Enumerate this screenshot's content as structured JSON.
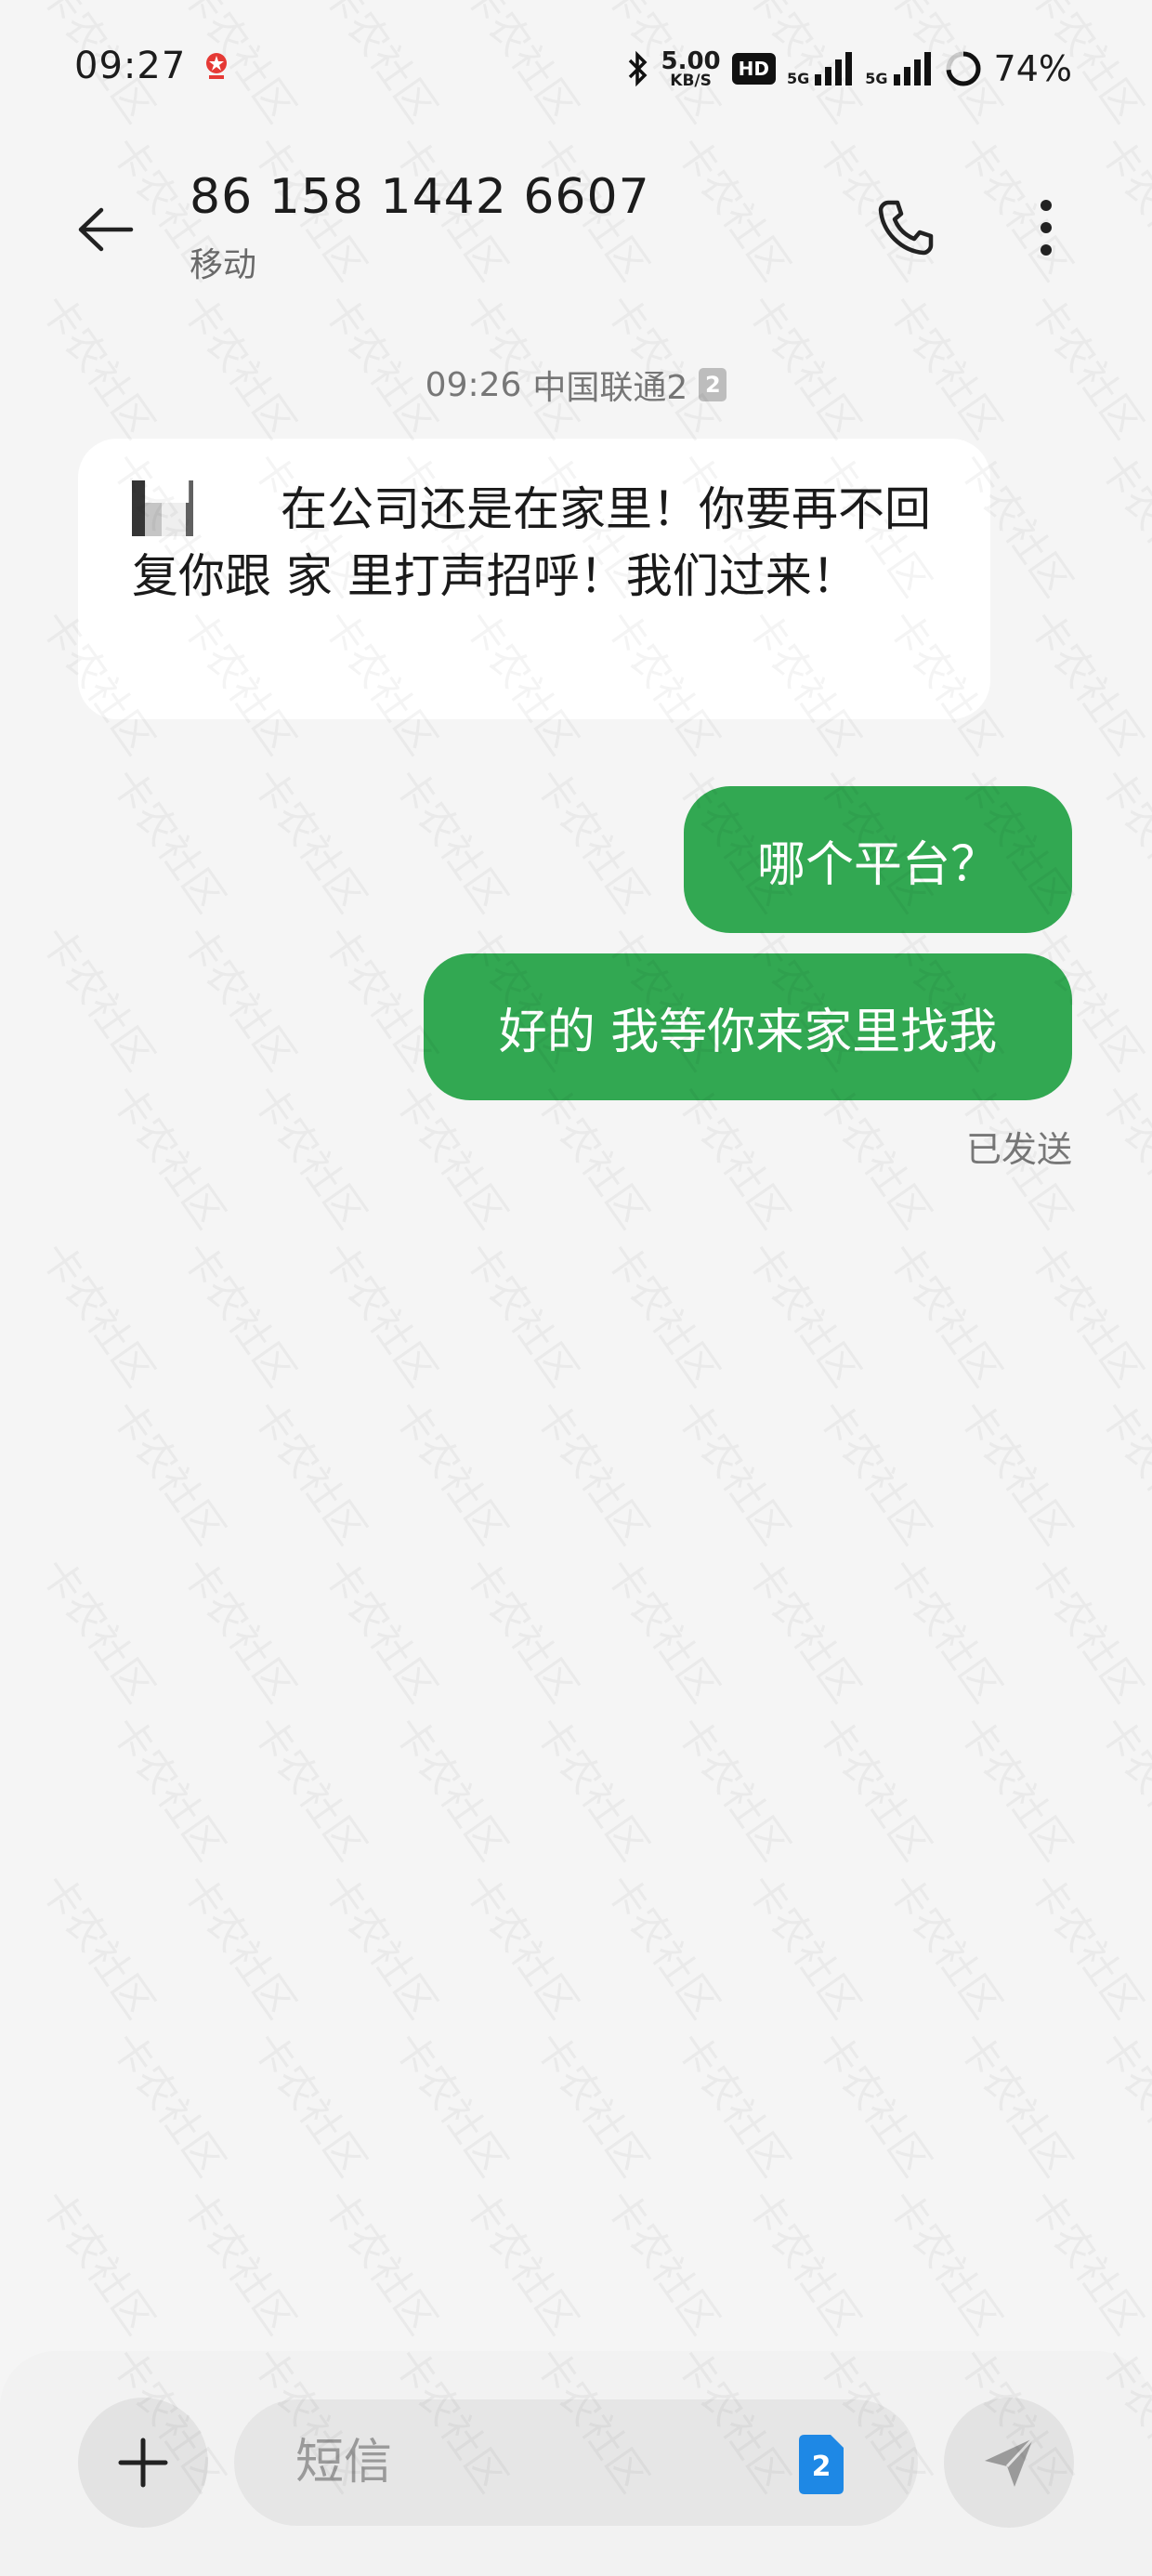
{
  "status_bar": {
    "time": "09:27",
    "net_speed_value": "5.00",
    "net_speed_unit": "KB/S",
    "hd_label": "HD",
    "net1_label": "5G",
    "net2_label": "5G",
    "battery_percent": "74%"
  },
  "header": {
    "contact_number": "86 158 1442 6607",
    "contact_carrier": "移动"
  },
  "conversation": {
    "timestamp": "09:26",
    "carrier_label": "中国联通2",
    "sim_badge": "2",
    "incoming_messages": [
      {
        "text": "在公司还是在家里！你要再不回复你跟 家 里打声招呼！我们过来！"
      }
    ],
    "outgoing_messages": [
      {
        "text": "哪个平台？"
      },
      {
        "text": "好的 我等你来家里找我"
      }
    ],
    "sent_status": "已发送"
  },
  "composer": {
    "placeholder": "短信"
  },
  "watermark_text": "卡农社区",
  "colors": {
    "outgoing_bubble": "#32a852",
    "incoming_bubble": "#ffffff",
    "background": "#f5f5f5",
    "sim_icon": "#1e88e5"
  }
}
